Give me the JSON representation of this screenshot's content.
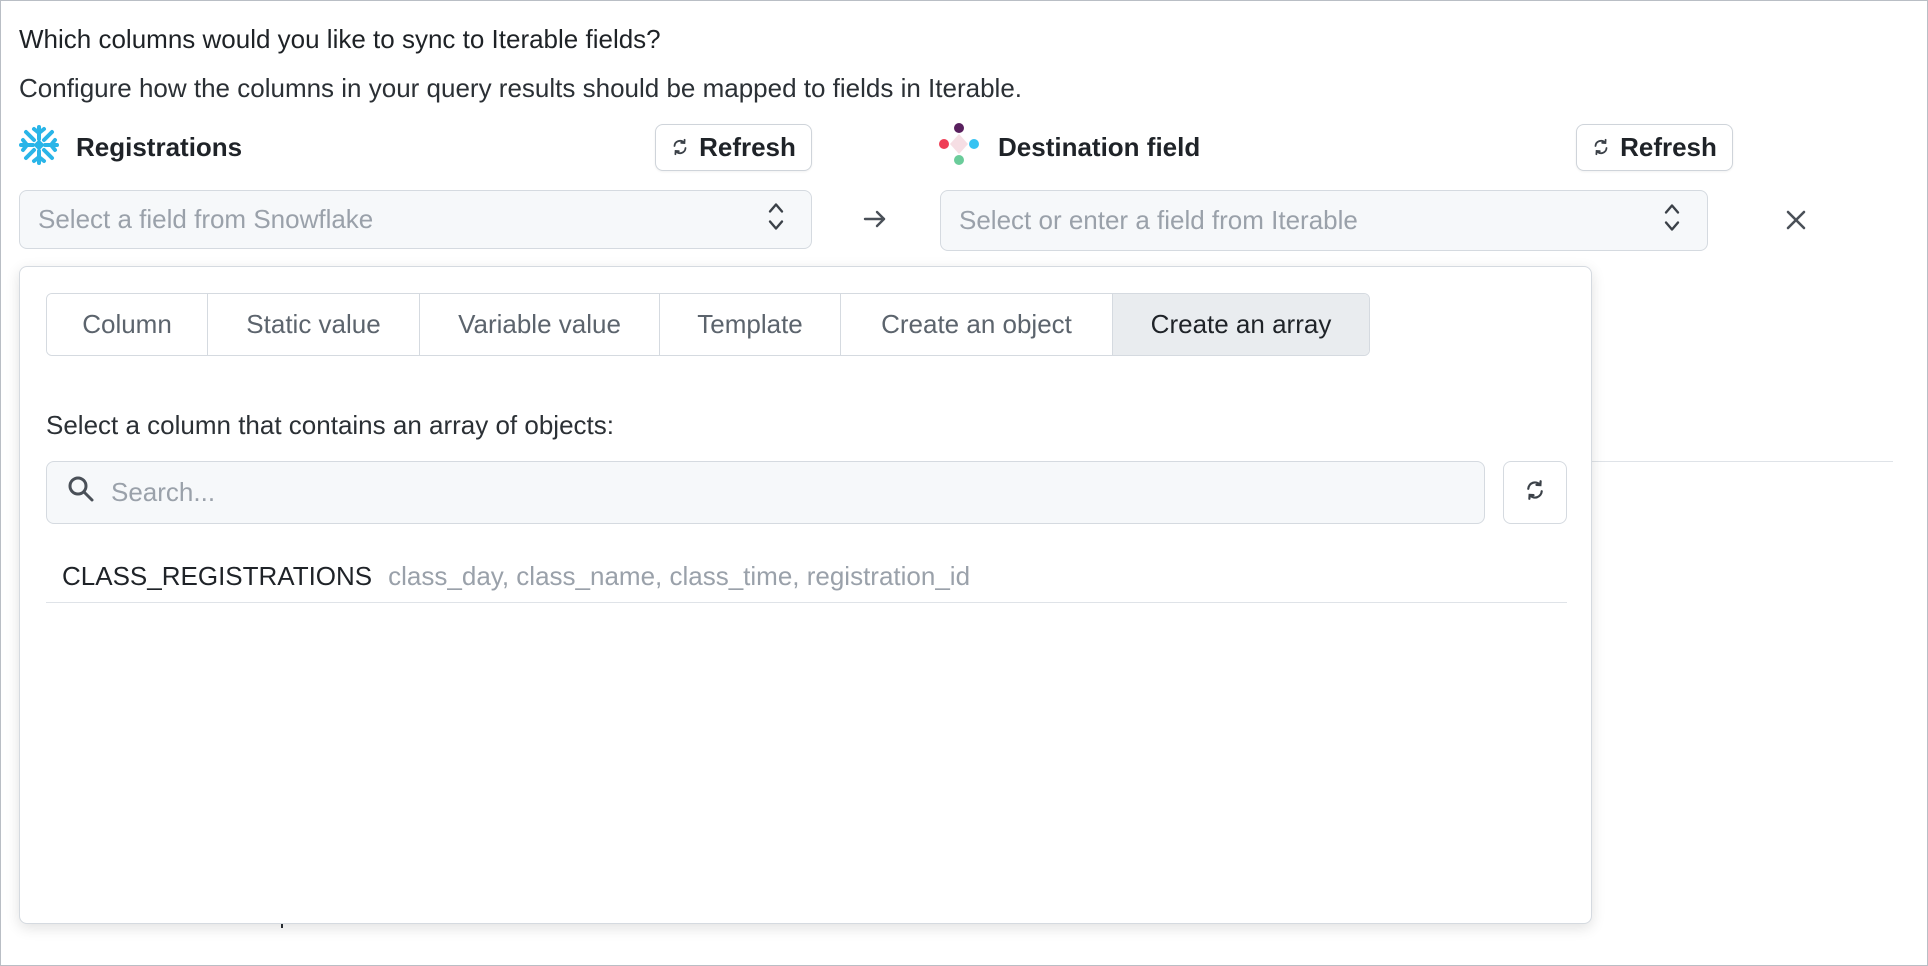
{
  "header": {
    "title": "Which columns would you like to sync to Iterable fields?",
    "subtitle": "Configure how the columns in your query results should be mapped to fields in Iterable."
  },
  "source": {
    "title": "Registrations",
    "icon": "snowflake-icon",
    "refresh_label": "Refresh",
    "select_placeholder": "Select a field from Snowflake"
  },
  "destination": {
    "title": "Destination field",
    "icon": "iterable-logo-icon",
    "refresh_label": "Refresh",
    "select_placeholder": "Select or enter a field from Iterable"
  },
  "popover": {
    "tabs": [
      {
        "label": "Column",
        "active": false
      },
      {
        "label": "Static value",
        "active": false
      },
      {
        "label": "Variable value",
        "active": false
      },
      {
        "label": "Template",
        "active": false
      },
      {
        "label": "Create an object",
        "active": false
      },
      {
        "label": "Create an array",
        "active": true
      }
    ],
    "instruction": "Select a column that contains an array of objects:",
    "search_placeholder": "Search...",
    "results": [
      {
        "name": "CLASS_REGISTRATIONS",
        "fields": "class_day, class_name, class_time, registration_id"
      }
    ]
  },
  "colors": {
    "snowflake": "#29b5e8",
    "active_tab_bg": "#e9ecef",
    "placeholder": "#9aa1aa"
  }
}
